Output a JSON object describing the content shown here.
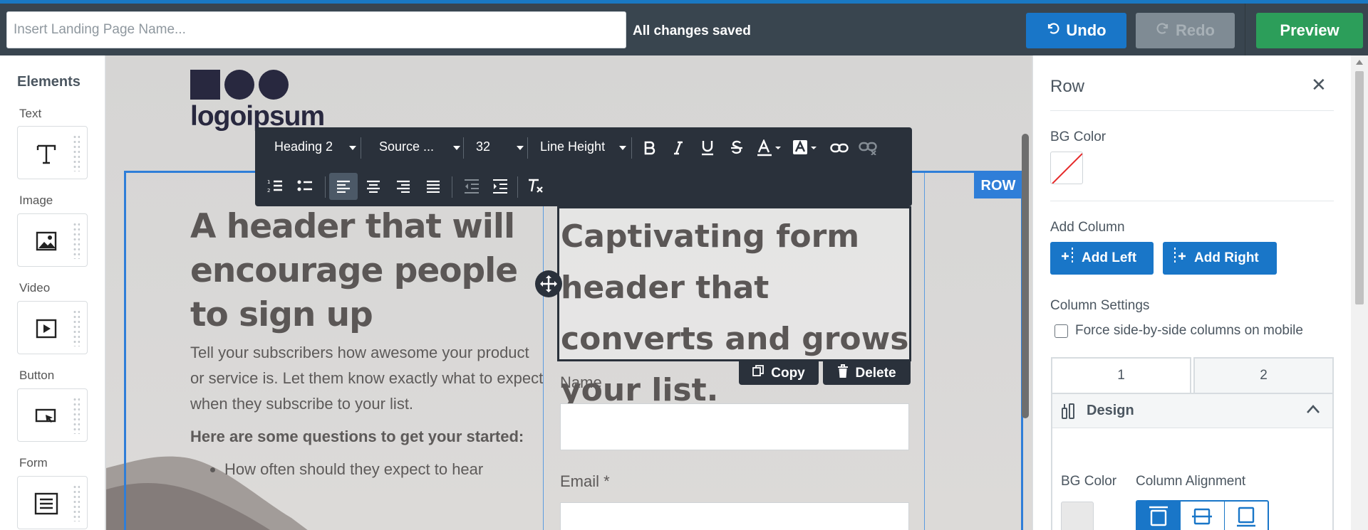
{
  "topbar": {
    "name_placeholder": "Insert Landing Page Name...",
    "status": "All changes saved",
    "undo_label": "Undo",
    "redo_label": "Redo",
    "preview_label": "Preview"
  },
  "elements_panel": {
    "title": "Elements",
    "items": [
      {
        "label": "Text",
        "icon": "text-icon"
      },
      {
        "label": "Image",
        "icon": "image-icon"
      },
      {
        "label": "Video",
        "icon": "video-icon"
      },
      {
        "label": "Button",
        "icon": "button-icon"
      },
      {
        "label": "Form",
        "icon": "form-icon"
      }
    ]
  },
  "canvas": {
    "logo_text": "logoipsum",
    "row_badge": "ROW",
    "headline": "A header that will encourage people to sign up",
    "body": "Tell your subscribers how awesome your product or service is. Let them know exactly what to expect when they subscribe to your list.",
    "questions_heading": "Here are some questions to get your started:",
    "bullet_1": "How often should they expect to hear",
    "form_header": "Captivating form header that converts and grows your list.",
    "copy_label": "Copy",
    "delete_label": "Delete",
    "name_label": "Name",
    "email_label": "Email *"
  },
  "toolbar": {
    "block_format": "Heading 2",
    "font_family": "Source ...",
    "font_size": "32",
    "line_height": "Line Height"
  },
  "settings_panel": {
    "title": "Row",
    "bg_color_label": "BG Color",
    "add_column_label": "Add Column",
    "add_left": "Add Left",
    "add_right": "Add Right",
    "column_settings_label": "Column Settings",
    "force_side_by_side": "Force side-by-side columns on mobile",
    "tabs": [
      "1",
      "2"
    ],
    "design_label": "Design",
    "col_bg_color_label": "BG Color",
    "column_alignment_label": "Column Alignment"
  },
  "colors": {
    "accent": "#1976c8",
    "success": "#2c9e5a",
    "topbar": "#39454f",
    "toolbar": "#2a313b",
    "row_outline": "#2f7ed8"
  }
}
